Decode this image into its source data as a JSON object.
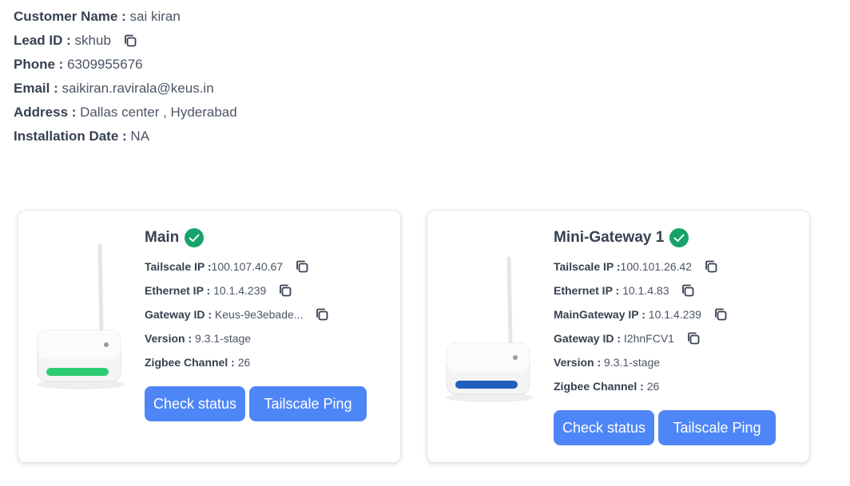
{
  "customer": {
    "name_label": "Customer Name :",
    "name_value": "sai kiran",
    "lead_label": "Lead ID :",
    "lead_value": "skhub",
    "phone_label": "Phone :",
    "phone_value": "6309955676",
    "email_label": "Email :",
    "email_value": "saikiran.ravirala@keus.in",
    "address_label": "Address :",
    "address_value": "Dallas center , Hyderabad",
    "install_label": "Installation Date :",
    "install_value": "NA"
  },
  "gateways": [
    {
      "title": "Main",
      "status": "online",
      "led_color": "#2ecc71",
      "fields": {
        "tailscale_label": "Tailscale IP :",
        "tailscale_value": "100.107.40.67",
        "ethernet_label": "Ethernet IP :",
        "ethernet_value": "10.1.4.239",
        "gateway_label": "Gateway ID :",
        "gateway_value": "Keus-9e3ebade...",
        "version_label": "Version :",
        "version_value": "9.3.1-stage",
        "zigbee_label": "Zigbee Channel :",
        "zigbee_value": "26"
      },
      "buttons": {
        "check": "Check status",
        "ping": "Tailscale Ping"
      }
    },
    {
      "title": "Mini-Gateway 1",
      "status": "online",
      "led_color": "#1f5fbf",
      "fields": {
        "tailscale_label": "Tailscale IP :",
        "tailscale_value": "100.101.26.42",
        "ethernet_label": "Ethernet IP :",
        "ethernet_value": "10.1.4.83",
        "main_label": "MainGateway IP :",
        "main_value": "10.1.4.239",
        "gateway_label": "Gateway ID :",
        "gateway_value": "I2hnFCV1",
        "version_label": "Version :",
        "version_value": "9.3.1-stage",
        "zigbee_label": "Zigbee Channel :",
        "zigbee_value": "26"
      },
      "buttons": {
        "check": "Check status",
        "ping": "Tailscale Ping"
      }
    }
  ],
  "colors": {
    "button": "#4f86f7",
    "status_ok": "#16a36a"
  }
}
